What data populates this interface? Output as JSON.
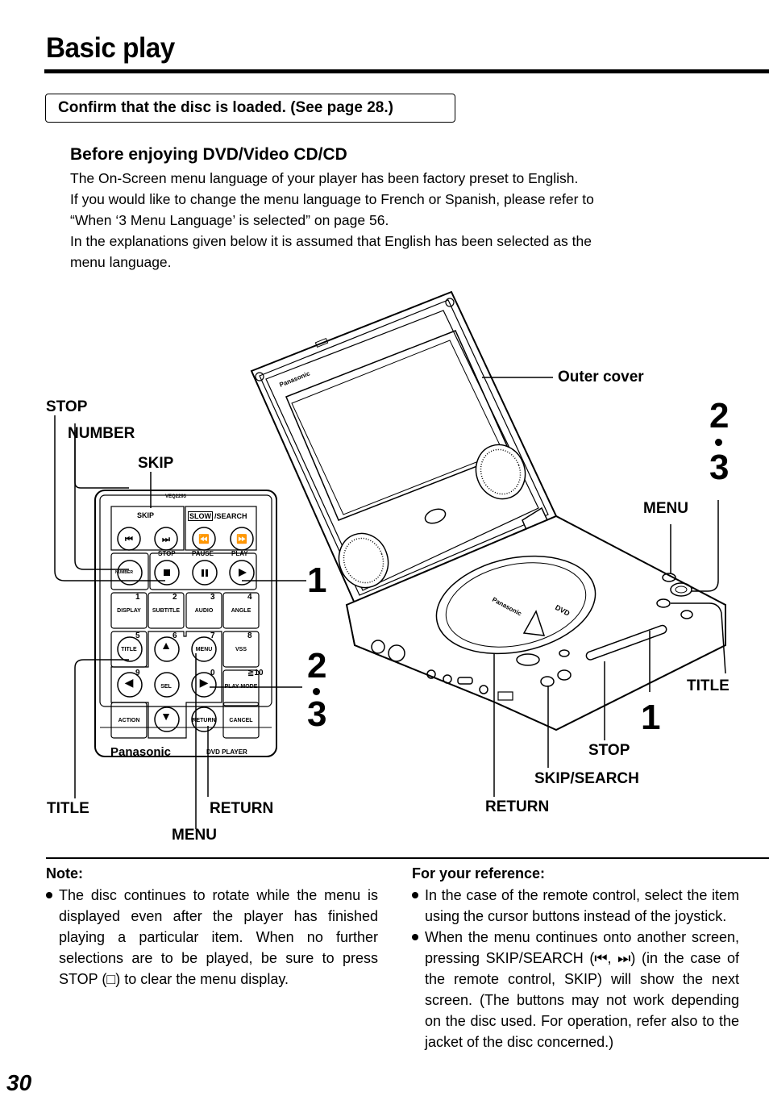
{
  "page": {
    "title": "Basic play",
    "page_number": "30"
  },
  "confirm": {
    "text": "Confirm that the disc is loaded. (See page 28.)"
  },
  "before": {
    "heading": "Before enjoying DVD/Video CD/CD",
    "lines": [
      "The On-Screen menu language of your player has been factory preset to English.",
      "If you would like to change the menu language to French or Spanish, please refer to",
      "“When ‘3 Menu Language’ is selected” on page 56.",
      "In the explanations given below it is assumed that English has been selected as the",
      "menu language."
    ]
  },
  "figure": {
    "remote_callouts": {
      "stop": "STOP",
      "number": "NUMBER",
      "skip": "SKIP",
      "title": "TITLE",
      "return": "RETURN",
      "menu": "MENU"
    },
    "player_callouts": {
      "outer_cover": "Outer cover",
      "menu": "MENU",
      "title": "TITLE",
      "stop": "STOP",
      "skip_search": "SKIP/SEARCH",
      "return": "RETURN"
    },
    "step_numbers": {
      "remote_step1": "1",
      "remote_step2": "2",
      "remote_step3": "3",
      "player_step1": "1",
      "player_step2": "2",
      "player_step3": "3"
    },
    "remote": {
      "model": "VEQ2293",
      "brand": "Panasonic",
      "product": "DVD PLAYER",
      "skip_label": "SKIP",
      "slow_label": "SLOW",
      "search_label": "/SEARCH",
      "stop_label": "STOP",
      "pause_label": "PAUSE",
      "play_label": "PLAY",
      "number_btn": "NUMBER",
      "keys": [
        {
          "label": "DISPLAY",
          "num": "1"
        },
        {
          "label": "SUBTITLE",
          "num": "2"
        },
        {
          "label": "AUDIO",
          "num": "3"
        },
        {
          "label": "ANGLE",
          "num": "4"
        },
        {
          "label": "TITLE",
          "num": "5"
        },
        {
          "label": "▲",
          "num": "6"
        },
        {
          "label": "MENU",
          "num": "7"
        },
        {
          "label": "VSS",
          "num": "8"
        },
        {
          "label": "◀",
          "num": "9"
        },
        {
          "label": "SEL",
          "num": ""
        },
        {
          "label": "▶",
          "num": "0"
        },
        {
          "label": "PLAY MODE",
          "num": "≧10"
        },
        {
          "label": "ACTION",
          "num": ""
        },
        {
          "label": "▼",
          "num": ""
        },
        {
          "label": "RETURN",
          "num": ""
        },
        {
          "label": "CANCEL",
          "num": ""
        }
      ]
    },
    "player": {
      "brand": "Panasonic",
      "disc_label": "DVD"
    }
  },
  "note": {
    "title": "Note:",
    "items": [
      "The disc continues to rotate while the menu is displayed even after the player has finished playing a particular item. When no further selections are to be played, be sure to press STOP (□) to clear the menu display."
    ]
  },
  "reference": {
    "title": "For your reference:",
    "items": [
      "In the case of the remote control, select the item using the cursor buttons instead of the joystick.",
      "When the menu continues onto another screen, pressing SKIP/SEARCH (⏮, ⏭) (in the case of the remote control, SKIP) will show the next screen. (The buttons may not work depending on the disc used. For operation, refer also to the jacket of the disc concerned.)"
    ]
  }
}
